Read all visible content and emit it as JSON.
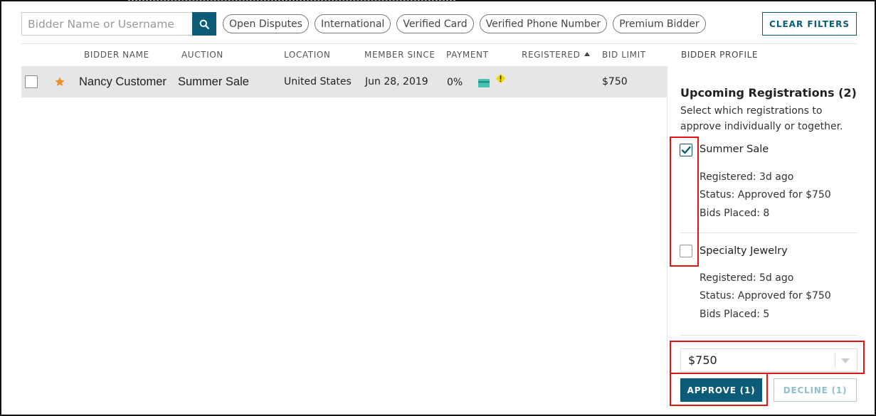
{
  "search": {
    "placeholder": "Bidder Name or Username",
    "icon": "search-icon"
  },
  "filters": [
    "Open Disputes",
    "International",
    "Verified Card",
    "Verified Phone Number",
    "Premium Bidder"
  ],
  "clear_filters_label": "CLEAR FILTERS",
  "columns": {
    "bidder_name": "BIDDER NAME",
    "auction": "AUCTION",
    "location": "LOCATION",
    "member_since": "MEMBER SINCE",
    "payment": "PAYMENT",
    "registered": "REGISTERED",
    "bid_limit": "BID LIMIT",
    "bidder_profile": "BIDDER PROFILE"
  },
  "rows": [
    {
      "name": "Nancy Customer",
      "auction": "Summer Sale",
      "location": "United States",
      "member_since": "Jun 28, 2019",
      "payment": "0%",
      "registered": "",
      "bid_limit": "$750",
      "starred": true
    }
  ],
  "panel": {
    "title": "Upcoming Registrations (2)",
    "description": "Select which registrations to approve individually or together.",
    "registrations": [
      {
        "name": "Summer Sale",
        "checked": true,
        "registered": "Registered: 3d ago",
        "status": "Status: Approved for $750",
        "bids": "Bids Placed: 8"
      },
      {
        "name": "Specialty Jewelry",
        "checked": false,
        "registered": "Registered: 5d ago",
        "status": "Status: Approved for $750",
        "bids": "Bids Placed: 5"
      }
    ],
    "bid_limit_select": "$750",
    "approve_label": "APPROVE (1)",
    "decline_label": "DECLINE (1)"
  },
  "colors": {
    "accent": "#0c5c77",
    "highlight": "#e01414",
    "star": "#f28c28",
    "row_bg": "#e6e6e6"
  }
}
